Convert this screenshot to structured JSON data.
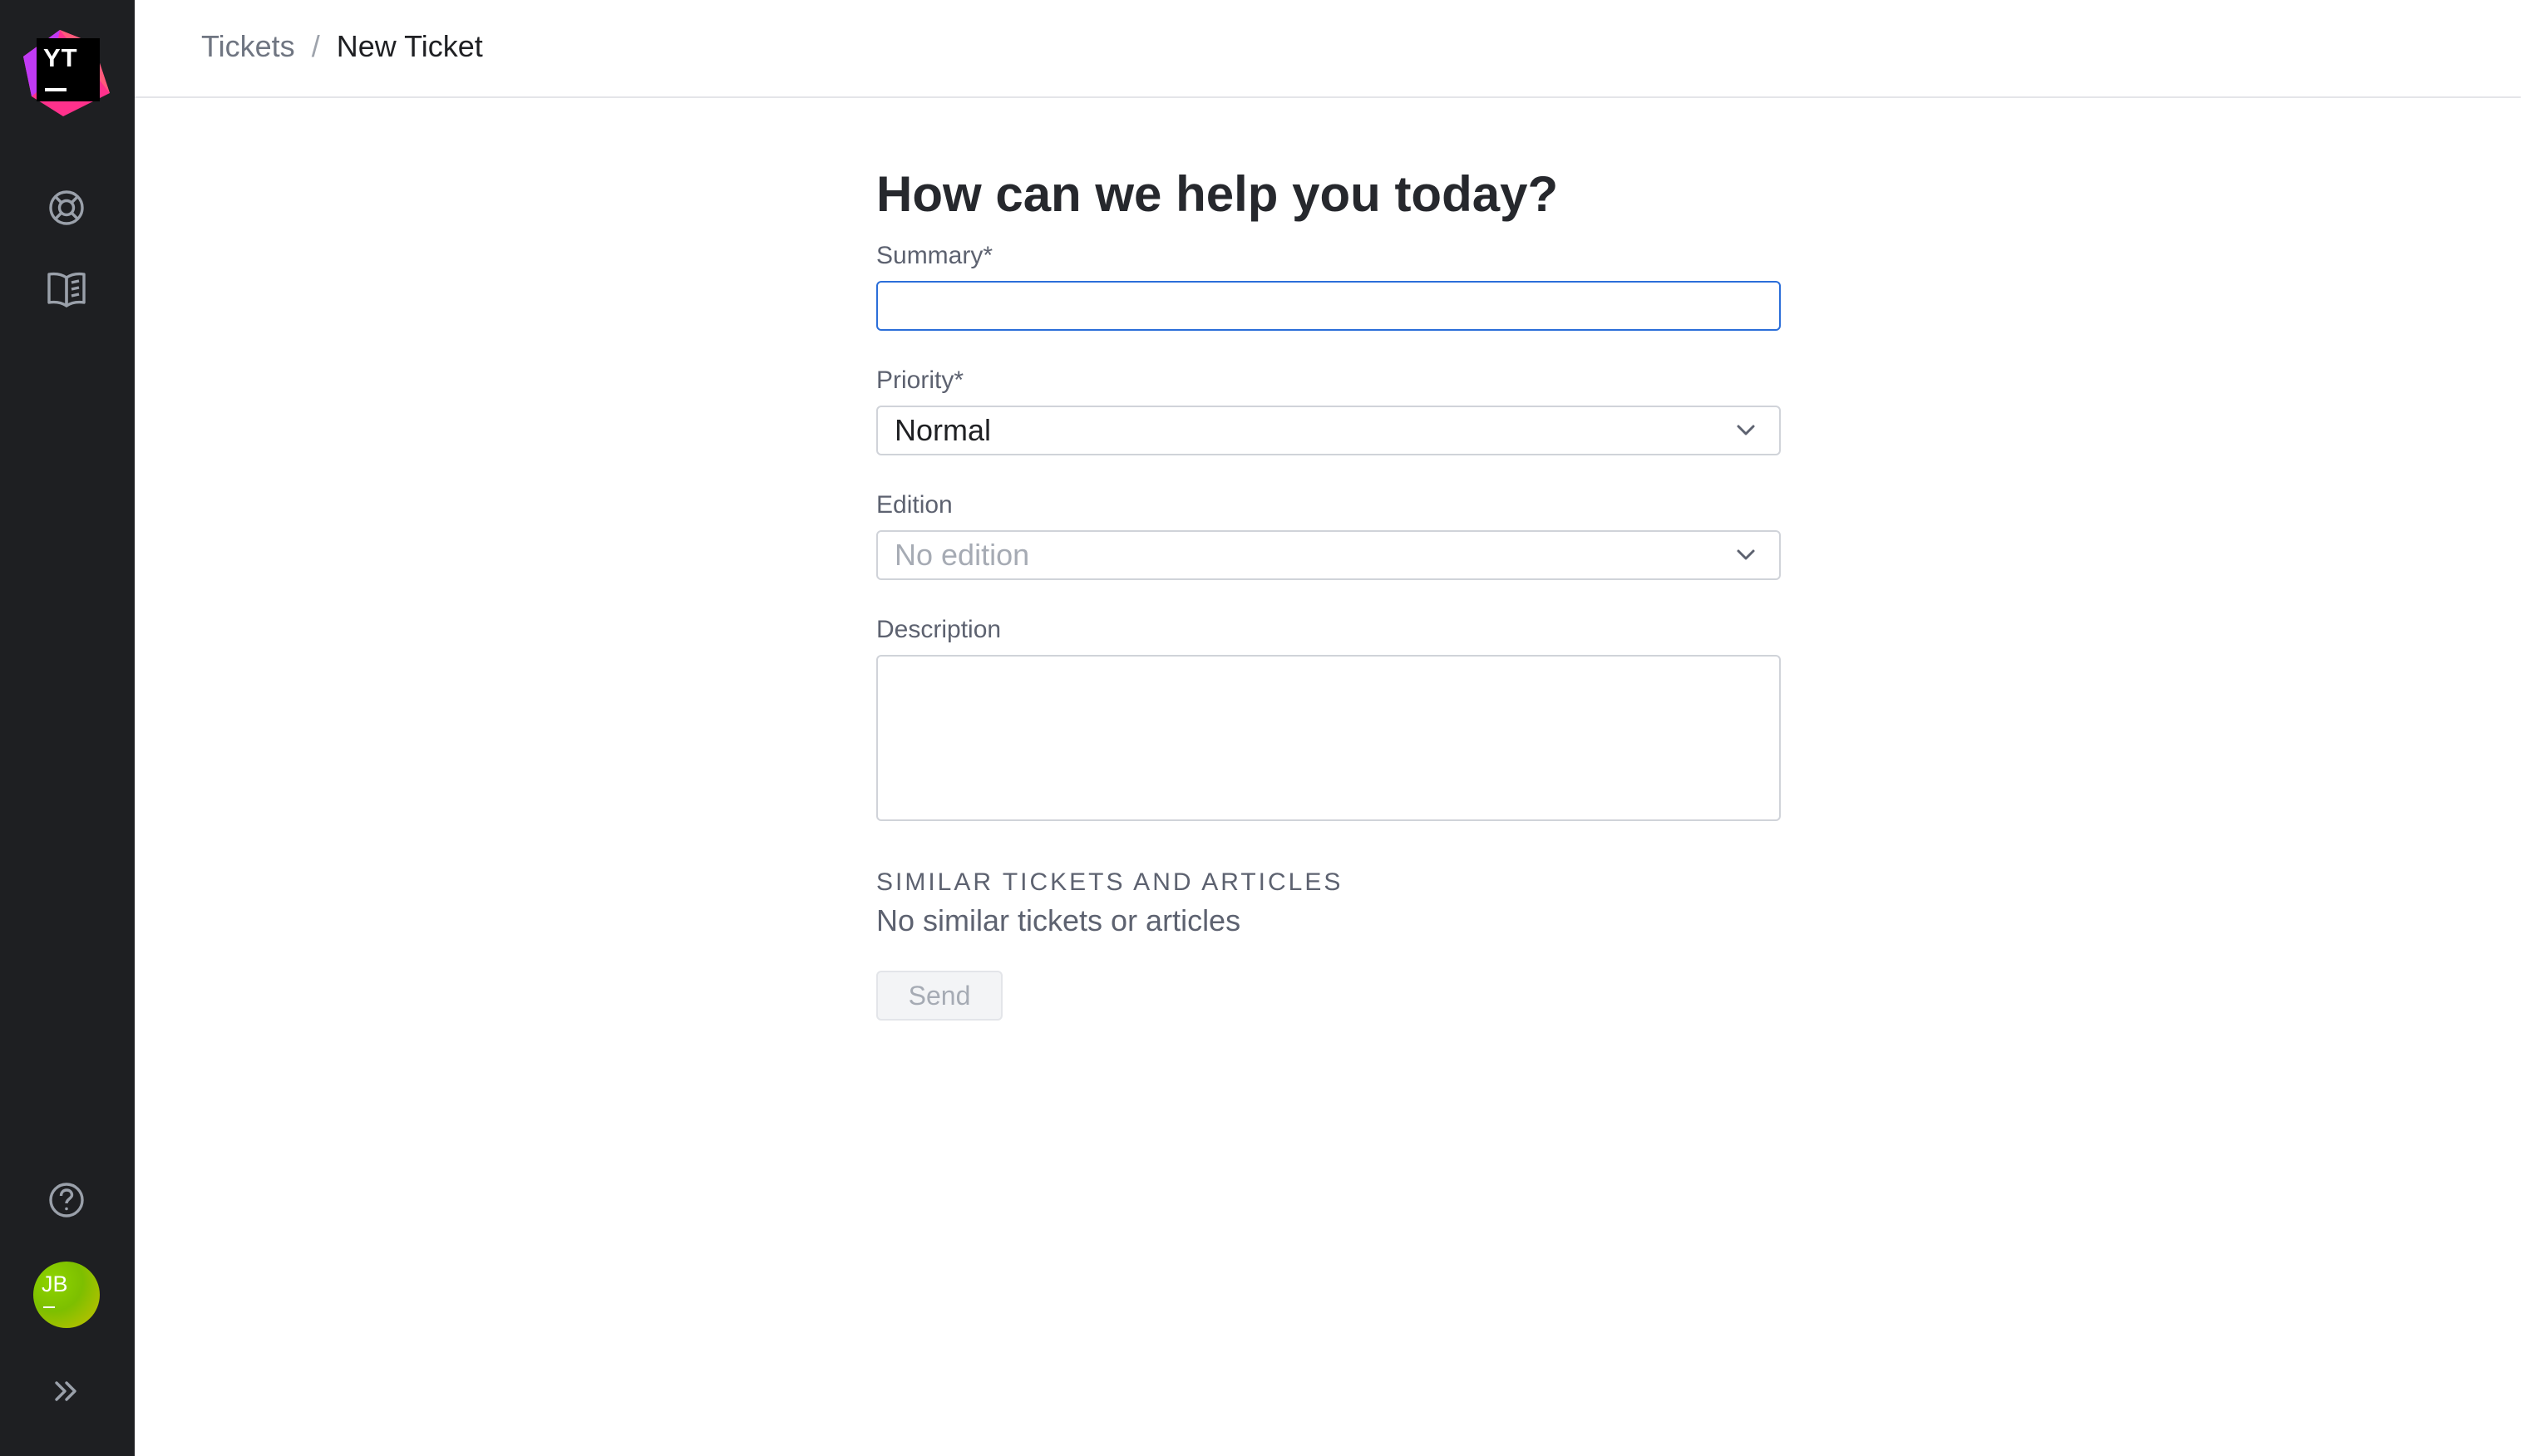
{
  "app": {
    "logo_text": "YT",
    "brand_colors": [
      "#ff318c",
      "#8e3fe0",
      "#1e1f22"
    ]
  },
  "sidebar": {
    "items": [
      {
        "name": "help-center-icon",
        "label": ""
      },
      {
        "name": "knowledge-base-icon",
        "label": ""
      }
    ],
    "bottom": {
      "help_icon": "help-icon",
      "avatar_initials": "JB",
      "expand_icon": "expand-icon"
    }
  },
  "breadcrumb": {
    "parent": "Tickets",
    "separator": "/",
    "current": "New Ticket"
  },
  "form": {
    "title": "How can we help you today?",
    "summary": {
      "label": "Summary*",
      "value": "",
      "placeholder": ""
    },
    "priority": {
      "label": "Priority*",
      "value": "Normal"
    },
    "edition": {
      "label": "Edition",
      "placeholder": "No edition"
    },
    "description": {
      "label": "Description",
      "value": ""
    },
    "similar": {
      "heading": "SIMILAR TICKETS AND ARTICLES",
      "empty_text": "No similar tickets or articles"
    },
    "send_label": "Send"
  },
  "colors": {
    "sidebar_bg": "#1e1f22",
    "focus_border": "#2b6ed9",
    "input_border": "#d0d3d9",
    "avatar": "#7dbf00"
  }
}
